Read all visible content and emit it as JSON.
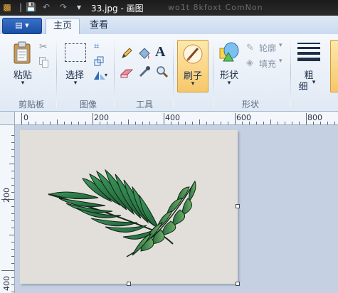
{
  "window": {
    "title": "33.jpg - 画图",
    "blurred_text": "wo1t  8kfoxt  ComNon"
  },
  "app_menu": {
    "label": "▤ ▾"
  },
  "tabs": [
    {
      "label": "主页",
      "active": true
    },
    {
      "label": "查看",
      "active": false
    }
  ],
  "ribbon": {
    "clipboard": {
      "paste_label": "粘贴",
      "group_label": "剪贴板"
    },
    "image": {
      "select_label": "选择",
      "group_label": "图像"
    },
    "tools": {
      "group_label": "工具"
    },
    "brush": {
      "label": "刷子"
    },
    "shapes": {
      "label": "形状",
      "outline_label": "轮廓",
      "fill_label": "填充",
      "group_label": "形状"
    },
    "size": {
      "label_line1": "粗",
      "label_line2": "细"
    }
  },
  "ruler": {
    "horizontal_labels": [
      "0",
      "200",
      "400",
      "600",
      "800"
    ],
    "vertical_labels": [
      "200",
      "400"
    ]
  },
  "colors": {
    "accent": "#f6c76a",
    "canvas": "#e2ded9",
    "workspace": "#c5d1e2",
    "leaf": "#2e7b4a"
  }
}
